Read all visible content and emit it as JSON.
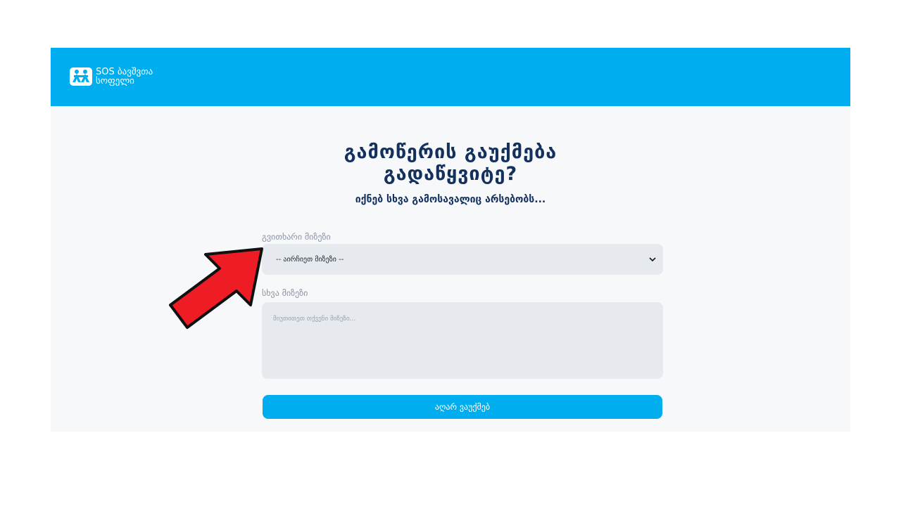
{
  "header": {
    "logo_line1": "SOS ბავშვთა",
    "logo_line2": "სოფელი",
    "background": "#00aeef"
  },
  "main": {
    "title_line1": "გამოწერის გაუქმება",
    "title_line2": "გადაწყვიტე?",
    "subtitle": "იქნებ სხვა გამოსავალიც არსებობს..."
  },
  "form": {
    "reason_label": "გვითხარი მიზეზი",
    "reason_selected": "-- აირჩიეთ მიზეზი --",
    "other_label": "სხვა მიზეზი",
    "other_placeholder": "მიუთითეთ თქვენი მიზეზი...",
    "submit_label": "აღარ ვაუქმებ"
  },
  "annotation": {
    "icon": "red-arrow-icon",
    "color": "#ee1c25"
  }
}
